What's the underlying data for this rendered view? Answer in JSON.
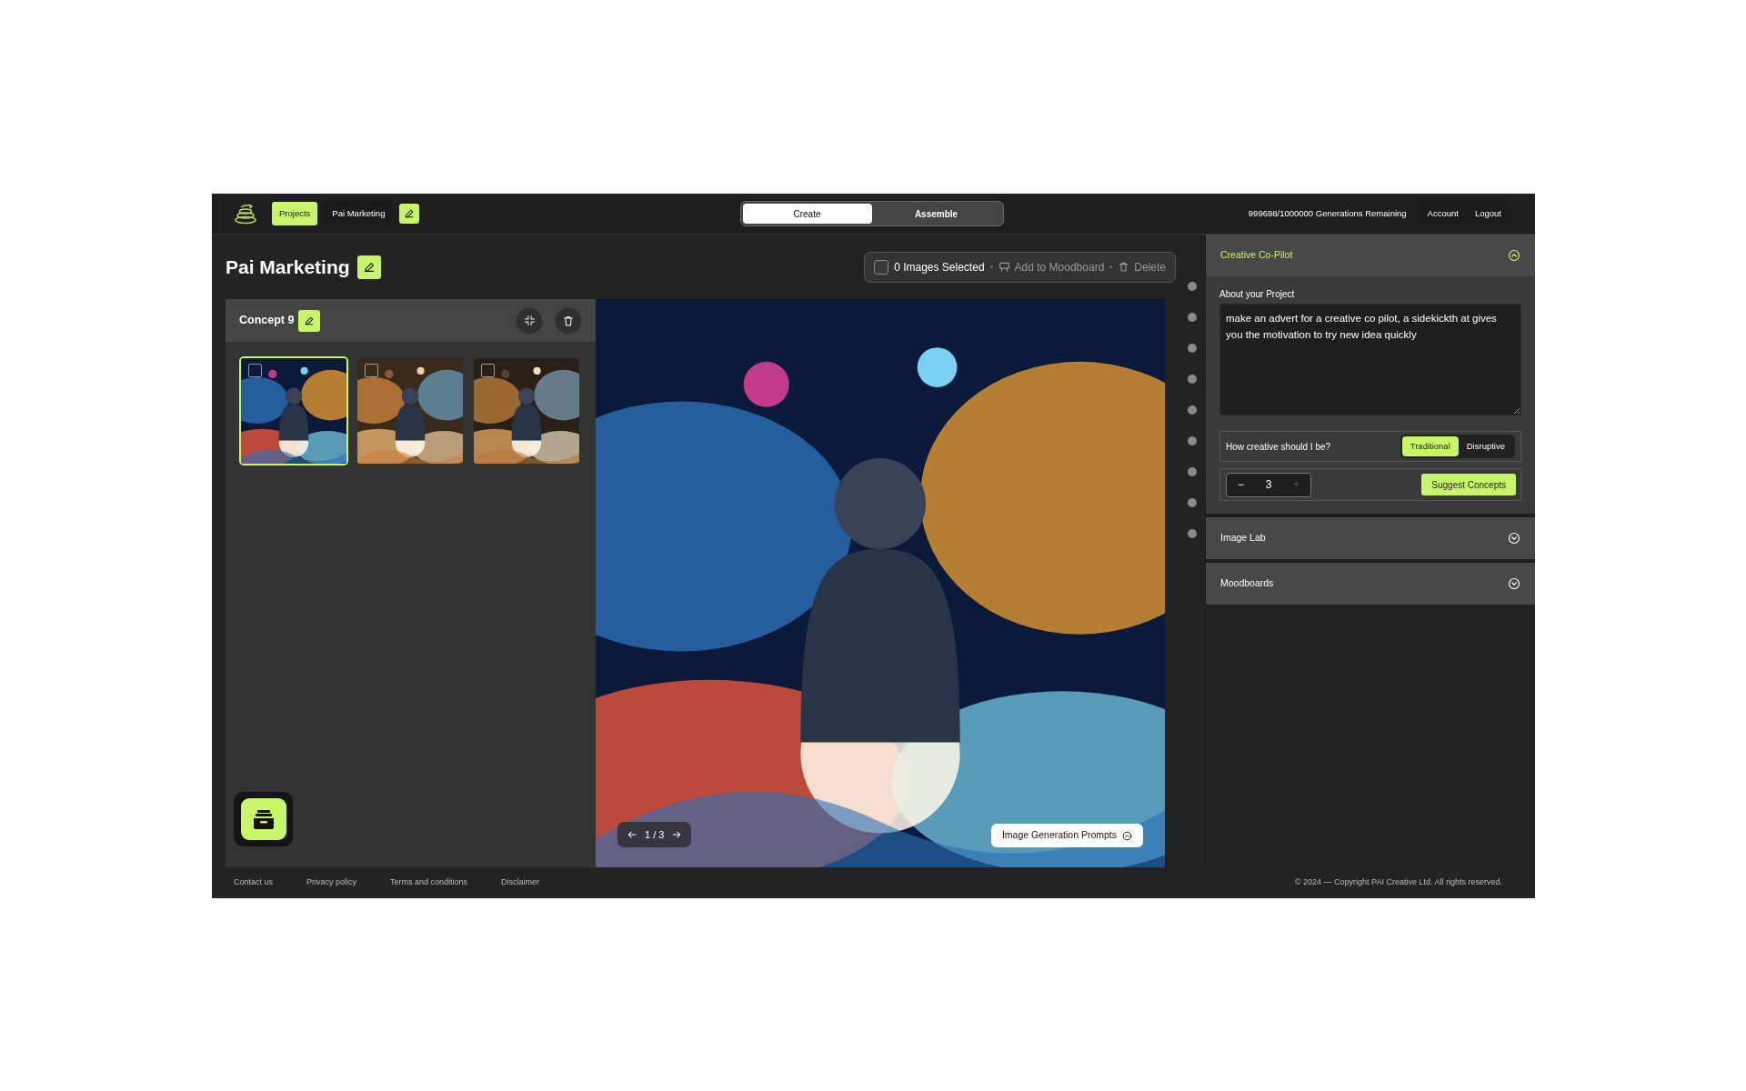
{
  "topbar": {
    "nav": [
      {
        "label": "Projects",
        "selected": true
      },
      {
        "label": "Pai Marketing",
        "selected": false
      }
    ],
    "mode_tabs": [
      {
        "label": "Create",
        "selected": true
      },
      {
        "label": "Assemble",
        "selected": false
      }
    ],
    "generations": "999698/1000000 Generations Remaining",
    "links": [
      "Account",
      "Logout"
    ]
  },
  "project": {
    "title": "Pai Marketing"
  },
  "selection_bar": {
    "checked": false,
    "count": "0 Images Selected",
    "actions": [
      {
        "kind": "moodboard",
        "label": "Add to Moodboard"
      },
      {
        "kind": "delete",
        "label": "Delete"
      }
    ]
  },
  "concept": {
    "title": "Concept 9",
    "thumbnails": [
      {
        "kind": "picture",
        "selected": true,
        "checked": false
      },
      {
        "kind": "picture",
        "selected": false,
        "checked": false
      },
      {
        "kind": "picture",
        "selected": false,
        "checked": false
      }
    ]
  },
  "viewer": {
    "kind": "picture",
    "pager": "1 / 3",
    "prompts_button": "Image Generation Prompts"
  },
  "copilot": {
    "title": "Creative Co-Pilot",
    "expanded": true,
    "about_label": "About your Project",
    "about_text": "make an advert for a creative co pilot, a sidekickth at gives you the motivation to try new idea quickly",
    "creativity_label": "How creative should I be?",
    "options": [
      {
        "label": "Traditional",
        "selected": true
      },
      {
        "label": "Disruptive",
        "selected": false
      }
    ],
    "stepper": {
      "decrement": "−",
      "value": "3",
      "increment": "+",
      "increment_disabled": true
    },
    "suggest": "Suggest Concepts"
  },
  "sections": [
    {
      "title": "Image Lab",
      "expanded": false
    },
    {
      "title": "Moodboards",
      "expanded": false
    }
  ],
  "footer": {
    "links": [
      "Contact us",
      "Privacy policy",
      "Terms and conditions",
      "Disclaimer"
    ],
    "copyright": "© 2024 — Copyright PAI Creative Ltd. All rights reserved."
  }
}
